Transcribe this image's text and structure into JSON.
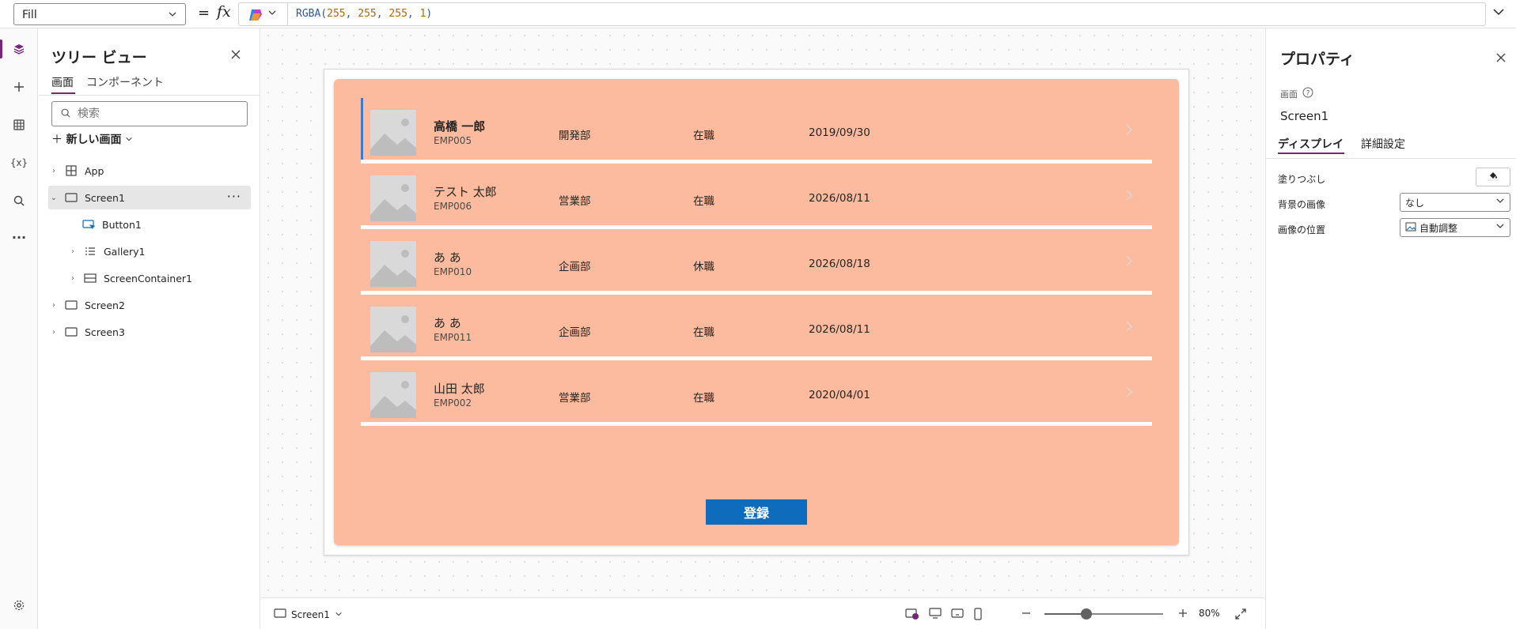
{
  "formula_bar": {
    "property": "Fill",
    "equals": "=",
    "fx": "fx",
    "formula_prefix": "RGBA(",
    "formula_args": [
      "255",
      "255",
      "255",
      "1"
    ],
    "formula_suffix": ")"
  },
  "tree": {
    "title": "ツリー ビュー",
    "tabs": [
      "画面",
      "コンポーネント"
    ],
    "search_placeholder": "検索",
    "new_screen": "新しい画面",
    "nodes": [
      {
        "label": "App"
      },
      {
        "label": "Screen1"
      },
      {
        "label": "Button1"
      },
      {
        "label": "Gallery1"
      },
      {
        "label": "ScreenContainer1"
      },
      {
        "label": "Screen2"
      },
      {
        "label": "Screen3"
      }
    ]
  },
  "gallery": {
    "items": [
      {
        "name": "高橋 一郎",
        "id": "EMP005",
        "dept": "開発部",
        "status": "在職",
        "date": "2019/09/30"
      },
      {
        "name": "テスト 太郎",
        "id": "EMP006",
        "dept": "営業部",
        "status": "在職",
        "date": "2026/08/11"
      },
      {
        "name": "あ あ",
        "id": "EMP010",
        "dept": "企画部",
        "status": "休職",
        "date": "2026/08/18"
      },
      {
        "name": "あ あ",
        "id": "EMP011",
        "dept": "企画部",
        "status": "在職",
        "date": "2026/08/11"
      },
      {
        "name": "山田 太郎",
        "id": "EMP002",
        "dept": "営業部",
        "status": "在職",
        "date": "2020/04/01"
      }
    ],
    "submit_label": "登録"
  },
  "status_bar": {
    "screen": "Screen1",
    "zoom_label": "80%",
    "zoom_level": 0.35
  },
  "properties": {
    "title": "プロパティ",
    "type_label": "画面",
    "name": "Screen1",
    "tabs": [
      "ディスプレイ",
      "詳細設定"
    ],
    "fill_label": "塗りつぶし",
    "bg_image_label": "背景の画像",
    "bg_image_value": "なし",
    "image_position_label": "画像の位置",
    "image_position_value": "自動調整"
  },
  "colors": {
    "accent": "#742774",
    "container_fill": "#fcbb9e",
    "button": "#0f6cbd"
  }
}
